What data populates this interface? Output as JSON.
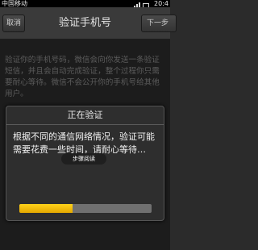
{
  "status_bar": {
    "carrier": "中国移动",
    "time": "20:4"
  },
  "header": {
    "title": "验证手机号",
    "cancel_label": "取消",
    "next_label": "下一步"
  },
  "info_text": "验证你的手机号码，微信会向你发送一条验证短信，并且会自动完成验证，整个过程你只需要耐心等待。微信不会公开你的手机号给其他用户。",
  "dialog": {
    "title": "正在验证",
    "message": "根据不同的通信网络情况，验证可能需要花费一些时间，请耐心等待…",
    "progress": 0.4,
    "progress_color": "#f5c400"
  },
  "watermark": {
    "label": "步骤阅读"
  }
}
